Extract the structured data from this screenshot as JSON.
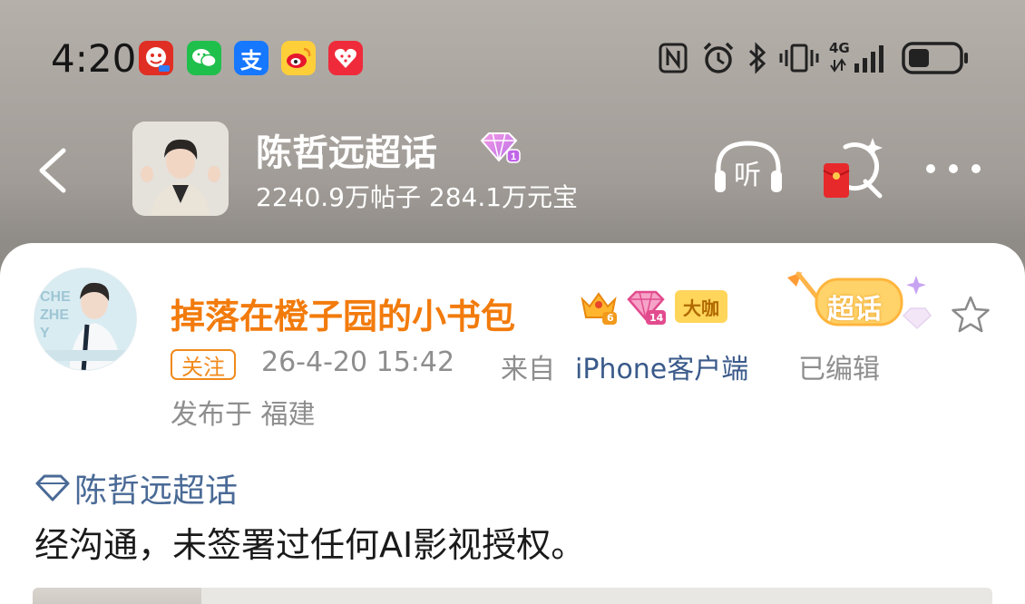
{
  "status_bar": {
    "time": "4:20",
    "app_icons": [
      "pinduoduo-icon",
      "wechat-icon",
      "alipay-icon",
      "weibo-icon",
      "taobao-icon"
    ],
    "system_icons": [
      "nfc-icon",
      "alarm-icon",
      "bluetooth-icon",
      "vibrate-icon",
      "signal-4g-icon",
      "battery-icon"
    ],
    "network": "4G",
    "alipay_glyph": "支"
  },
  "header": {
    "topic_name": "陈哲远超话",
    "stats": "2240.9万帖子 284.1万元宝",
    "listen_label": "听"
  },
  "post": {
    "username": "掉落在橙子园的小书包",
    "level_badge_1": "6",
    "level_badge_2": "14",
    "daka_label": "大咖",
    "sticker_label": "超话",
    "follow_label": "关注",
    "timestamp": "26-4-20 15:42",
    "source_prefix": "来自",
    "source": "iPhone客户端",
    "edited": "已编辑",
    "location": "发布于 福建",
    "topic_link": "陈哲远超话",
    "text": "经沟通，未签署过任何AI影视授权。"
  },
  "colors": {
    "username": "#f27b0c",
    "link": "#4a6a96",
    "meta": "#8e8e8e",
    "follow": "#f08a1c"
  }
}
